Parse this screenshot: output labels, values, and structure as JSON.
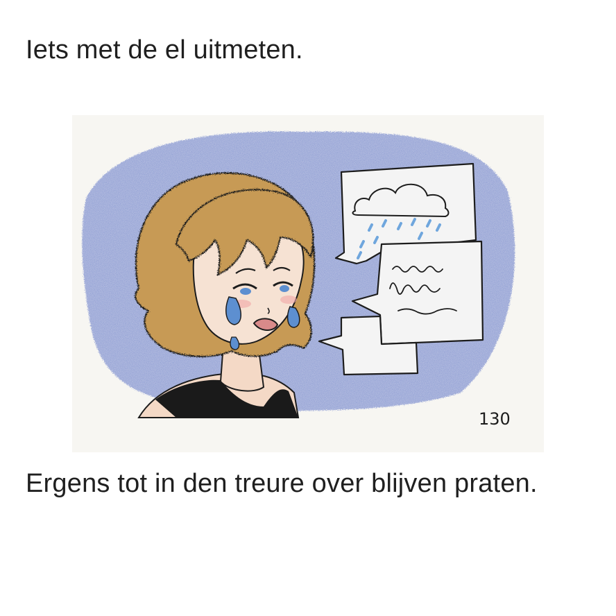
{
  "caption_top": "Iets met de el uitmeten.",
  "caption_bottom": "Ergens tot in den treure over blijven praten.",
  "illustration": {
    "page_number": "130",
    "colors": {
      "paper": "#f7f6f2",
      "sky_blue": "#5b79c9",
      "hair": "#c79a55",
      "skin": "#f4d9c6",
      "outline": "#1c1c1c",
      "tear_blue": "#5d8fd0",
      "bubble_fill": "#f4f4f4",
      "rain_blue": "#6fa6dd"
    }
  }
}
